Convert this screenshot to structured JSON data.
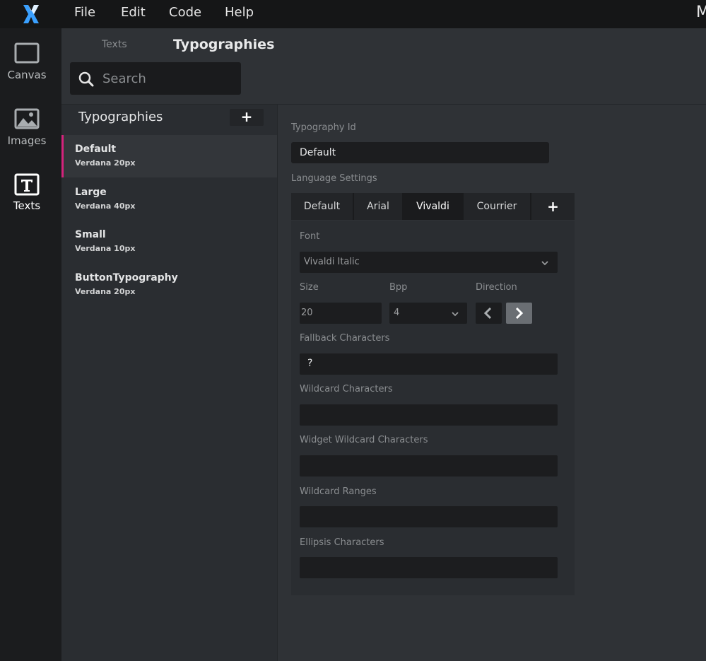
{
  "menu": {
    "items": [
      "File",
      "Edit",
      "Code",
      "Help"
    ],
    "right_cut": "M"
  },
  "rail": {
    "items": [
      {
        "label": "Canvas",
        "icon": "canvas-icon"
      },
      {
        "label": "Images",
        "icon": "image-icon"
      },
      {
        "label": "Texts",
        "icon": "text-icon",
        "active": true
      }
    ]
  },
  "header": {
    "tabs": [
      {
        "label": "Texts",
        "active": false
      },
      {
        "label": "Typographies",
        "active": true
      }
    ],
    "search_placeholder": "Search"
  },
  "list": {
    "title": "Typographies",
    "add_label": "+",
    "items": [
      {
        "name": "Default",
        "font": "Verdana  20px",
        "selected": true
      },
      {
        "name": "Large",
        "font": "Verdana  40px"
      },
      {
        "name": "Small",
        "font": "Verdana  10px"
      },
      {
        "name": "ButtonTypography",
        "font": "Verdana  20px"
      }
    ]
  },
  "detail": {
    "typography_id_label": "Typography Id",
    "typography_id_value": "Default",
    "language_settings_label": "Language Settings",
    "language_tabs": [
      "Default",
      "Arial",
      "Vivaldi",
      "Courrier"
    ],
    "active_language_tab": "Vivaldi",
    "add_language_label": "+",
    "font_label": "Font",
    "font_value": "Vivaldi Italic",
    "size_label": "Size",
    "size_value": "20",
    "bpp_label": "Bpp",
    "bpp_value": "4",
    "direction_label": "Direction",
    "direction_selected": "right",
    "fallback_label": "Fallback Characters",
    "fallback_value": "?",
    "wildcard_label": "Wildcard Characters",
    "wildcard_value": "",
    "widget_wildcard_label": "Widget Wildcard Characters",
    "widget_wildcard_value": "",
    "wildcard_ranges_label": "Wildcard Ranges",
    "wildcard_ranges_value": "",
    "ellipsis_label": "Ellipsis Characters",
    "ellipsis_value": ""
  },
  "colors": {
    "accent": "#d4237c",
    "logo_blue": "#3aa0ff",
    "background": "#2f3236"
  }
}
